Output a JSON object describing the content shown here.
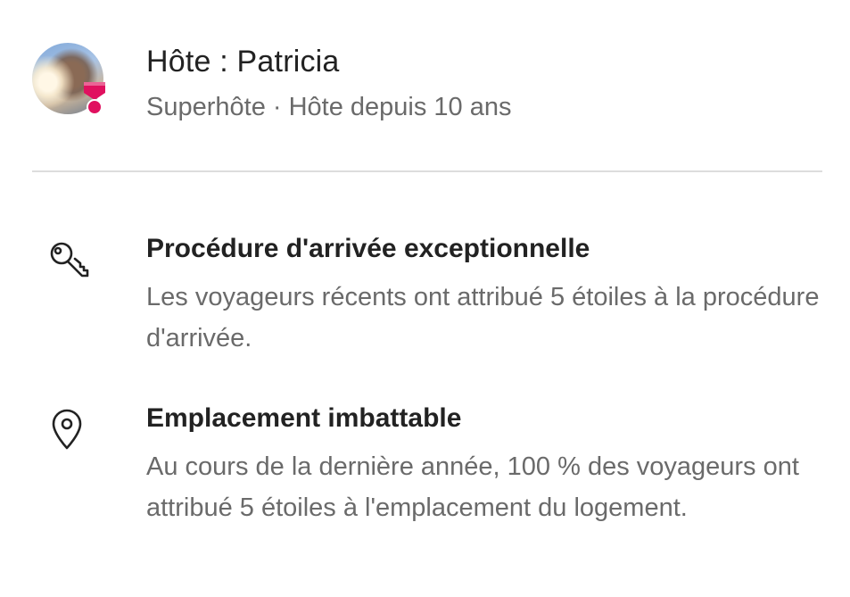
{
  "host": {
    "title": "Hôte : Patricia",
    "subtitle": "Superhôte · Hôte depuis 10 ans",
    "avatar_icon": "host-avatar-photo",
    "badge_icon": "superhost-badge-icon",
    "badge_color": "#e0115f"
  },
  "highlights": [
    {
      "icon": "key-icon",
      "title": "Procédure d'arrivée exceptionnelle",
      "description": "Les voyageurs récents ont attribué 5 étoiles à la procédure d'arrivée."
    },
    {
      "icon": "location-pin-icon",
      "title": "Emplacement imbattable",
      "description": "Au cours de la dernière année, 100 % des voyageurs ont attribué 5 étoiles à l'emplacement du logement."
    }
  ],
  "colors": {
    "text_primary": "#222222",
    "text_secondary": "#6a6a6a",
    "divider": "#dddddd",
    "accent": "#e0115f"
  }
}
